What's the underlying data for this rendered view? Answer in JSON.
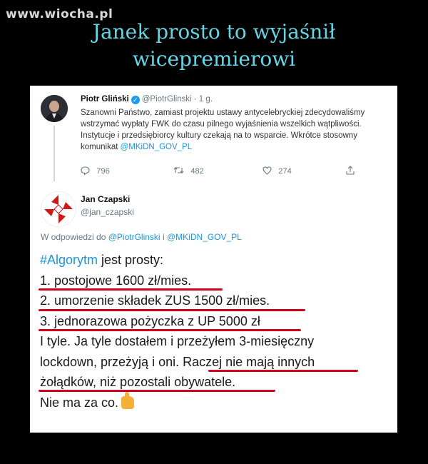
{
  "watermark": "www.wiocha.pl",
  "title_line1": "Janek prosto to wyjaśnił",
  "title_line2": "wicepremierowi",
  "tweet1": {
    "name": "Piotr Gliński",
    "handle": "@PiotrGlinski",
    "time": "· 1 g.",
    "body_prefix": "Szanowni Państwo, zamiast projektu ustawy antycelebryckiej zdecydowaliśmy wstrzymać wypłaty FWK do czasu pilnego wyjaśnienia wszelkich wątpliwości. Instytucje i przedsiębiorcy kultury czekają na to wsparcie. Wkrótce stosowny komunikat ",
    "mention": "@MKiDN_GOV_PL",
    "replies": "796",
    "retweets": "482",
    "likes": "274"
  },
  "tweet2": {
    "name": "Jan Czapski",
    "handle": "@jan_czapski",
    "reply_prefix": "W odpowiedzi do",
    "reply_mention1": "@PiotrGlinski",
    "reply_and": "i",
    "reply_mention2": "@MKiDN_GOV_PL",
    "hashtag": "#Algorytm",
    "line1_rest": " jest prosty:",
    "line2": "1. postojowe 1600 zł/mies.",
    "line3": "2. umorzenie składek ZUS 1500 zł/mies.",
    "line4": "3. jednorazowa pożyczka z UP 5000 zł",
    "line5": "I tyle. Ja tyle dostałem i przeżyłem 3-miesięczny",
    "line6a": "lockdown, przeżyją i oni. ",
    "line6b": "Raczej nie mają innych",
    "line7": "żołądków, niż pozostali obywatele.",
    "line8": "Nie ma za co."
  },
  "colors": {
    "title": "#64d7e6",
    "annotation_red": "#d0021b",
    "link_blue": "#1b95e0"
  }
}
